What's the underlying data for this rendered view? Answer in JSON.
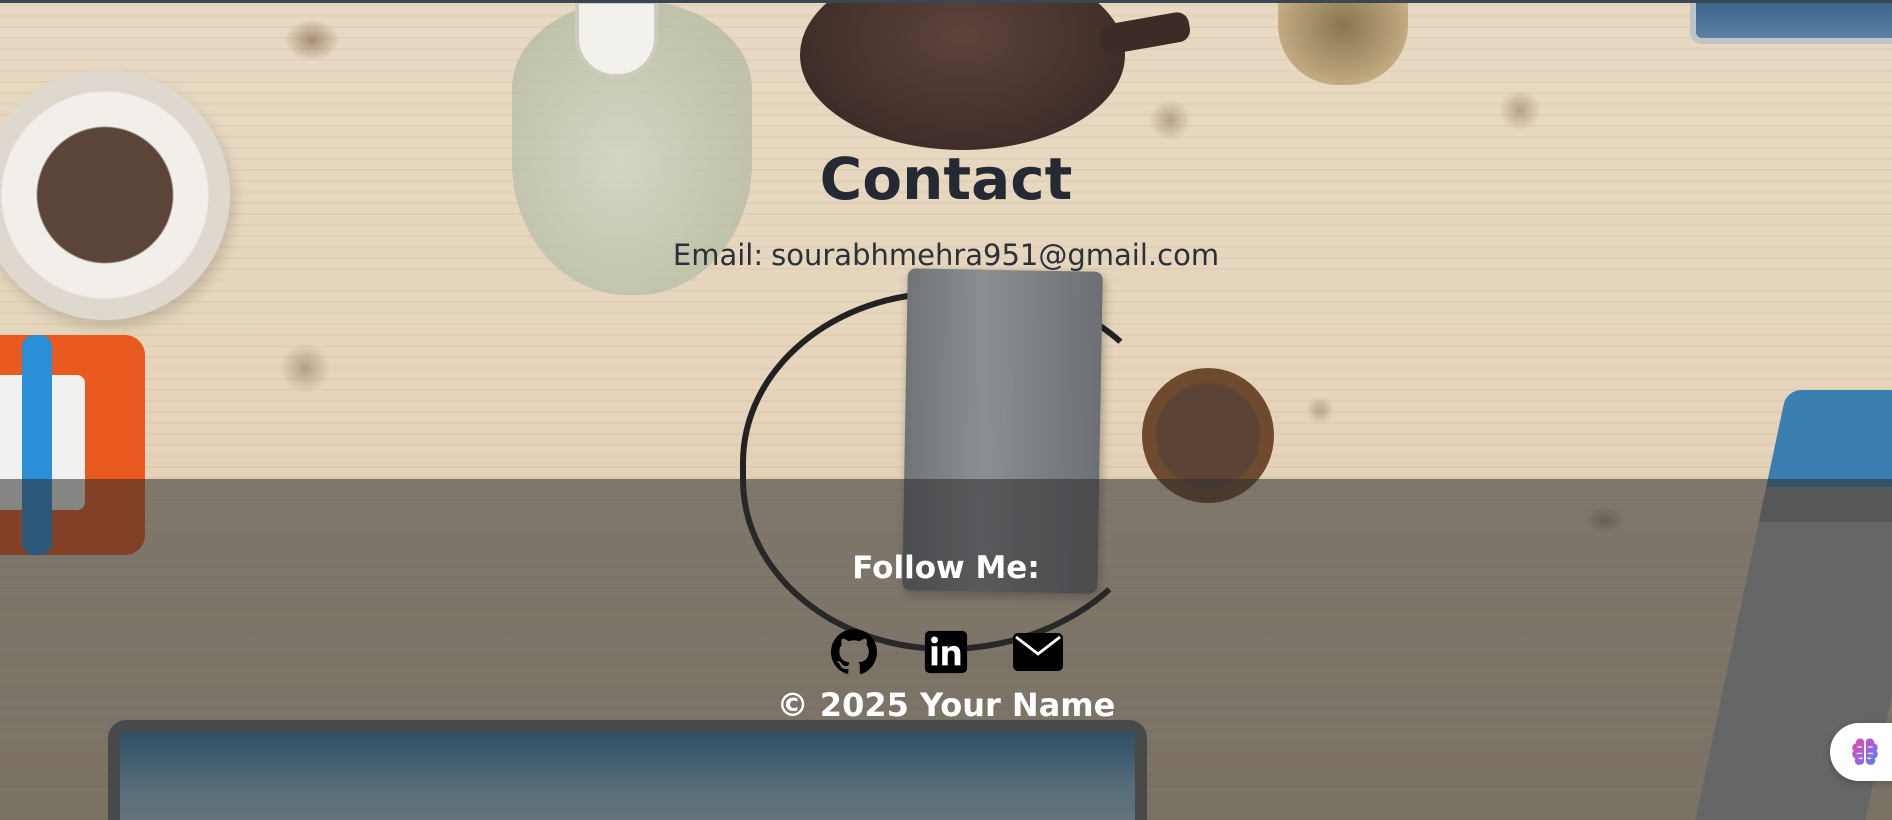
{
  "contact": {
    "title": "Contact",
    "email_label": "Email:",
    "email_value": "sourabhmehra951@gmail.com"
  },
  "footer": {
    "follow_heading": "Follow Me:",
    "social_links": [
      {
        "icon": "github-icon",
        "name": "GitHub"
      },
      {
        "icon": "linkedin-icon",
        "name": "LinkedIn"
      },
      {
        "icon": "envelope-icon",
        "name": "Email"
      }
    ],
    "copyright": "© 2025 Your Name"
  },
  "floating_widget": {
    "icon": "brain-icon"
  },
  "colors": {
    "heading_text": "#232a33",
    "footer_text": "#ffffff",
    "footer_overlay": "#2d2d2d",
    "top_border": "#3a4652"
  }
}
